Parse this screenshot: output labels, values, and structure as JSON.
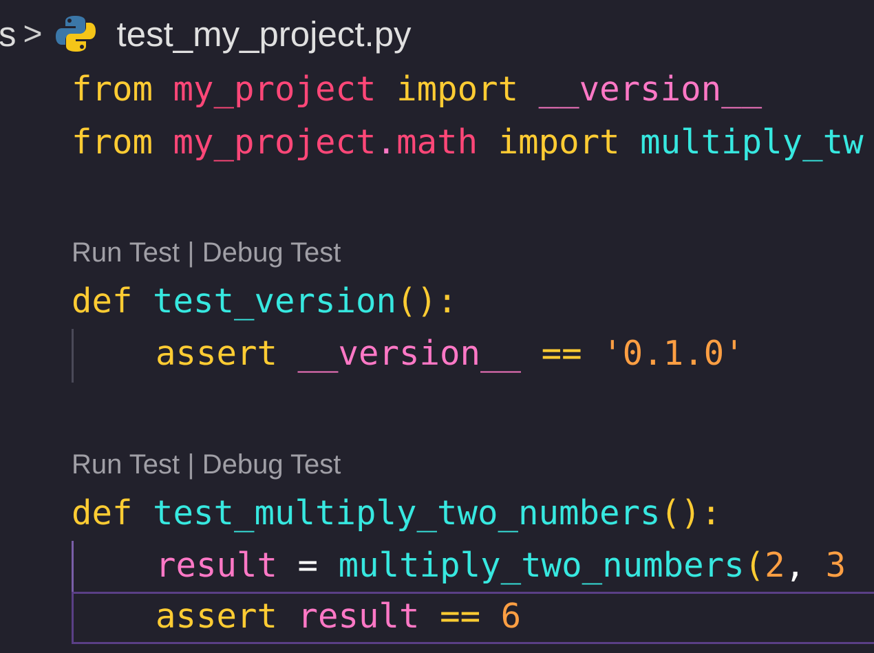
{
  "breadcrumb": {
    "prev_segment": "s",
    "separator": ">",
    "file_icon": "python-icon",
    "file_name": "test_my_project.py"
  },
  "code": {
    "line1": {
      "from": "from",
      "module": "my_project",
      "import": "import",
      "name": "__version__"
    },
    "line2": {
      "from": "from",
      "module": "my_project",
      "dot": ".",
      "submodule": "math",
      "import": "import",
      "name": "multiply_tw"
    },
    "codelens1": {
      "run": "Run Test",
      "sep": " | ",
      "debug": "Debug Test"
    },
    "line3": {
      "def": "def",
      "fn": "test_version",
      "paren": "():"
    },
    "line4": {
      "assert": "assert",
      "name": "__version__",
      "op": "==",
      "str": "'0.1.0'"
    },
    "codelens2": {
      "run": "Run Test",
      "sep": " | ",
      "debug": "Debug Test"
    },
    "line5": {
      "def": "def",
      "fn": "test_multiply_two_numbers",
      "paren": "():"
    },
    "line6": {
      "var": "result",
      "eq": "=",
      "fn": "multiply_two_numbers",
      "paren": "(",
      "arg1": "2",
      "comma": ",",
      "arg2": "3"
    },
    "line7": {
      "assert": "assert",
      "var": "result",
      "op": "==",
      "num": "6"
    }
  },
  "colors": {
    "background": "#22212c",
    "keyword": "#ffcc33",
    "module": "#ff4778",
    "function": "#37e8e0",
    "dunder": "#ff78c6",
    "string": "#ff9f43",
    "codelens": "#a09fa6"
  }
}
